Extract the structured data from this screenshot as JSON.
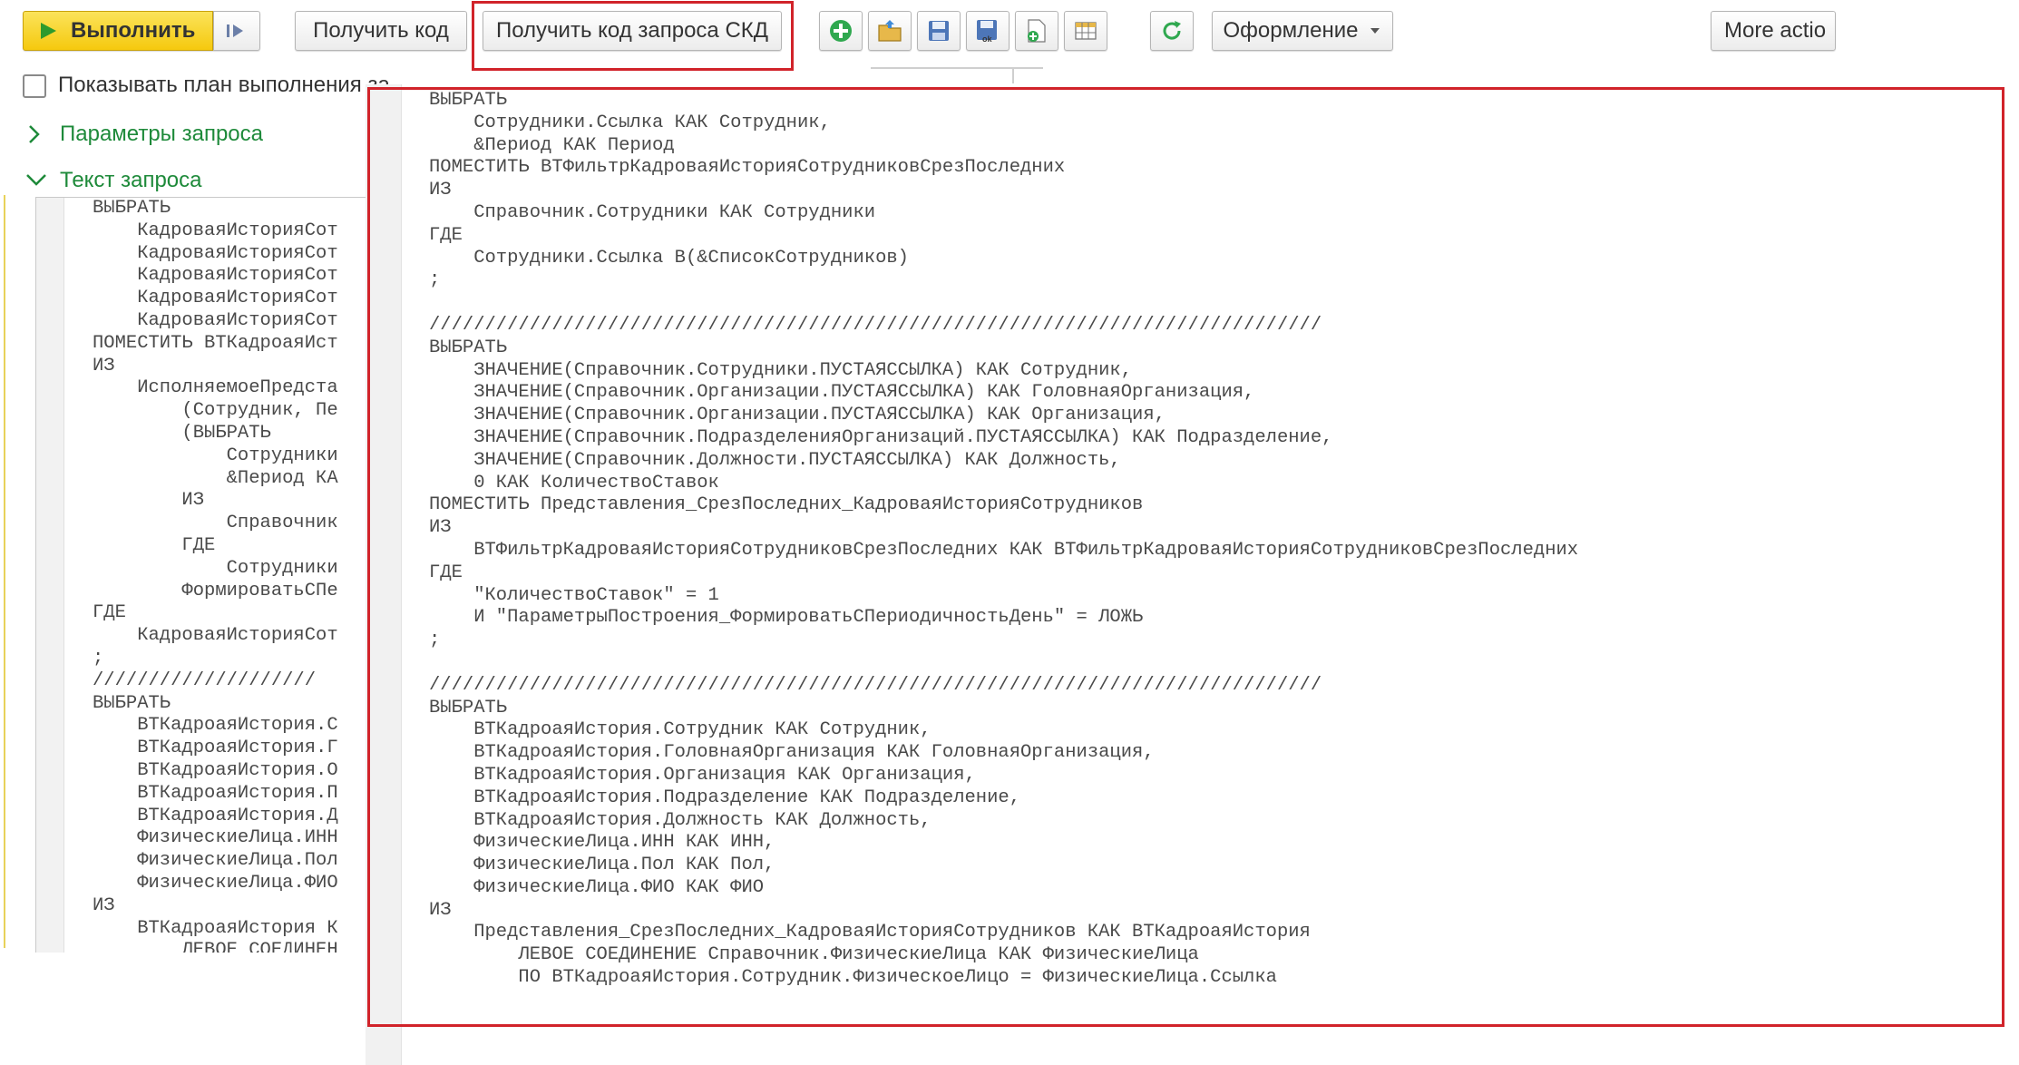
{
  "toolbar": {
    "run_label": "Выполнить",
    "get_code_label": "Получить код",
    "get_skd_code_label": "Получить код запроса СКД",
    "format_label": "Оформление",
    "more_label": "More actio",
    "icons": [
      "add-icon",
      "open-folder-icon",
      "save-icon",
      "save-ok-icon",
      "new-file-icon",
      "table-icon",
      "refresh-icon"
    ],
    "colors": {
      "run_bg": "#f5c90e",
      "play": "#2d9a2d",
      "highlight": "#d1232a"
    }
  },
  "options": {
    "show_plan_label": "Показывать план выполнения за"
  },
  "groups": {
    "params_label": "Параметры запроса",
    "text_label": "Текст запроса",
    "title_color": "#1e8a3a"
  },
  "left_code": [
    "ВЫБРАТЬ",
    "    КадроваяИсторияСот",
    "    КадроваяИсторияСот",
    "    КадроваяИсторияСот",
    "    КадроваяИсторияСот",
    "    КадроваяИсторияСот",
    "ПОМЕСТИТЬ ВТКадроаяИст",
    "ИЗ",
    "    ИсполняемоеПредста",
    "        (Сотрудник, Пе",
    "        (ВЫБРАТЬ",
    "            Сотрудники",
    "            &Период КА",
    "        ИЗ",
    "            Справочник",
    "        ГДЕ",
    "            Сотрудники",
    "        ФормироватьСПе",
    "ГДЕ",
    "    КадроваяИсторияСот",
    ";",
    "////////////////////",
    "ВЫБРАТЬ",
    "    ВТКадроаяИстория.С",
    "    ВТКадроаяИстория.Г",
    "    ВТКадроаяИстория.О",
    "    ВТКадроаяИстория.П",
    "    ВТКадроаяИстория.Д",
    "    ФизическиеЛица.ИНН",
    "    ФизическиеЛица.Пол",
    "    ФизическиеЛица.ФИО",
    "ИЗ",
    "    ВТКадроаяИстория К",
    "        ЛЕВОЕ СОЕДИНЕН"
  ],
  "overlay_code": [
    "ВЫБРАТЬ",
    "    Сотрудники.Ссылка КАК Сотрудник,",
    "    &Период КАК Период",
    "ПОМЕСТИТЬ ВТФильтрКадроваяИсторияСотрудниковСрезПоследних",
    "ИЗ",
    "    Справочник.Сотрудники КАК Сотрудники",
    "ГДЕ",
    "    Сотрудники.Ссылка В(&СписокСотрудников)",
    ";",
    "",
    "////////////////////////////////////////////////////////////////////////////////",
    "ВЫБРАТЬ",
    "    ЗНАЧЕНИЕ(Справочник.Сотрудники.ПУСТАЯССЫЛКА) КАК Сотрудник,",
    "    ЗНАЧЕНИЕ(Справочник.Организации.ПУСТАЯССЫЛКА) КАК ГоловнаяОрганизация,",
    "    ЗНАЧЕНИЕ(Справочник.Организации.ПУСТАЯССЫЛКА) КАК Организация,",
    "    ЗНАЧЕНИЕ(Справочник.ПодразделенияОрганизаций.ПУСТАЯССЫЛКА) КАК Подразделение,",
    "    ЗНАЧЕНИЕ(Справочник.Должности.ПУСТАЯССЫЛКА) КАК Должность,",
    "    0 КАК КоличествоСтавок",
    "ПОМЕСТИТЬ Представления_СрезПоследних_КадроваяИсторияСотрудников",
    "ИЗ",
    "    ВТФильтрКадроваяИсторияСотрудниковСрезПоследних КАК ВТФильтрКадроваяИсторияСотрудниковСрезПоследних",
    "ГДЕ",
    "    \"КоличествоСтавок\" = 1",
    "    И \"ПараметрыПостроения_ФормироватьСПериодичностьДень\" = ЛОЖЬ",
    ";",
    "",
    "////////////////////////////////////////////////////////////////////////////////",
    "ВЫБРАТЬ",
    "    ВТКадроаяИстория.Сотрудник КАК Сотрудник,",
    "    ВТКадроаяИстория.ГоловнаяОрганизация КАК ГоловнаяОрганизация,",
    "    ВТКадроаяИстория.Организация КАК Организация,",
    "    ВТКадроаяИстория.Подразделение КАК Подразделение,",
    "    ВТКадроаяИстория.Должность КАК Должность,",
    "    ФизическиеЛица.ИНН КАК ИНН,",
    "    ФизическиеЛица.Пол КАК Пол,",
    "    ФизическиеЛица.ФИО КАК ФИО",
    "ИЗ",
    "    Представления_СрезПоследних_КадроваяИсторияСотрудников КАК ВТКадроаяИстория",
    "        ЛЕВОЕ СОЕДИНЕНИЕ Справочник.ФизическиеЛица КАК ФизическиеЛица",
    "        ПО ВТКадроаяИстория.Сотрудник.ФизическоеЛицо = ФизическиеЛица.Ссылка"
  ]
}
